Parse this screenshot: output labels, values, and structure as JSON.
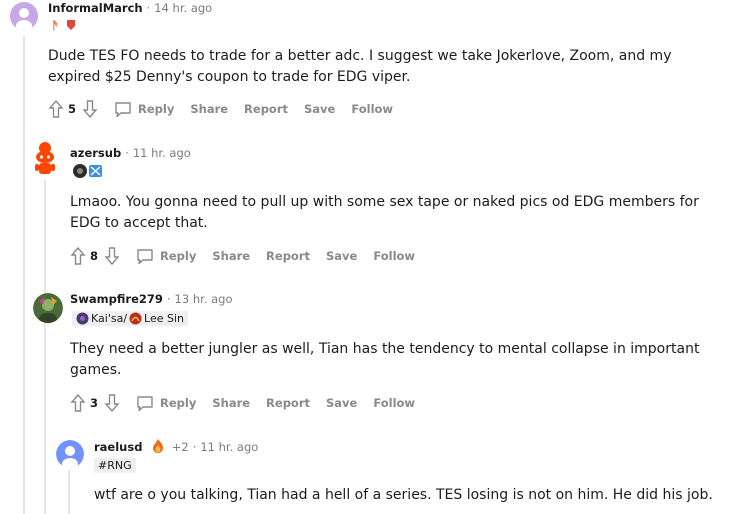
{
  "comments": [
    {
      "username": "InformalMarch",
      "time": "14 hr. ago",
      "body": "Dude TES FO needs to trade for a better adc. I suggest we take Jokerlove, Zoom, and my expired $25 Denny's coupon to trade for EDG viper.",
      "votes": "5"
    },
    {
      "username": "azersub",
      "time": "11 hr. ago",
      "body": "Lmaoo. You gonna need to pull up with some sex tape or naked pics od EDG members for EDG to accept that.",
      "votes": "8"
    },
    {
      "username": "Swampfire279",
      "time": "13 hr. ago",
      "flair": "Kai'sa/",
      "flair2": "Lee Sin",
      "body": "They need a better jungler as well, Tian has the tendency to mental collapse in important games.",
      "votes": "3"
    },
    {
      "username": "raelusd",
      "extra": "+2",
      "time": "11 hr. ago",
      "flair": "#RNG",
      "body": "wtf are o you talking, Tian had a hell of a series. TES losing is not on him. He did his job."
    }
  ],
  "actions": {
    "reply": "Reply",
    "share": "Share",
    "report": "Report",
    "save": "Save",
    "follow": "Follow"
  },
  "colors": {
    "meta": "#7c7c7c",
    "action": "#878a8c",
    "thread": "#e3e5e8"
  }
}
